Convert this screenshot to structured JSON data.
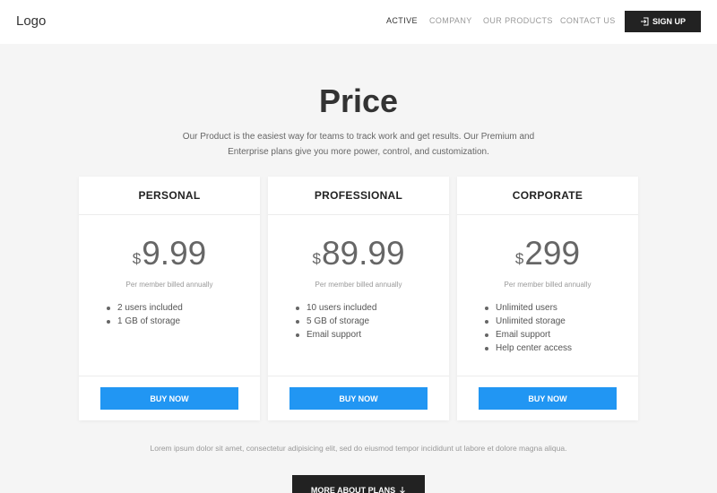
{
  "nav": {
    "logo": "Logo",
    "links": [
      "ACTIVE",
      "COMPANY",
      "OUR PRODUCTS",
      "CONTACT US"
    ],
    "signup_label": "SIGN UP",
    "signup_icon": "sign-in-icon"
  },
  "hero": {
    "title": "Price",
    "intro": "Our Product is the easiest way for teams to track work and get results. Our Premium and Enterprise plans give you more power, control, and customization."
  },
  "plans": [
    {
      "name": "PERSONAL",
      "currency": "$",
      "price": "9.99",
      "billing": "Per member billed annually",
      "features": [
        "2 users included",
        "1 GB of storage"
      ],
      "button": "BUY NOW"
    },
    {
      "name": "PROFESSIONAL",
      "currency": "$",
      "price": "89.99",
      "billing": "Per member billed annually",
      "features": [
        "10 users included",
        "5 GB of storage",
        "Email support"
      ],
      "button": "BUY NOW"
    },
    {
      "name": "CORPORATE",
      "currency": "$",
      "price": "299",
      "billing": "Per member billed annually",
      "features": [
        "Unlimited users",
        "Unlimited storage",
        "Email support",
        "Help center access"
      ],
      "button": "BUY NOW"
    }
  ],
  "footer": {
    "note": "Lorem ipsum dolor sit amet, consectetur adipisicing elit, sed do eiusmod tempor incididunt ut labore et dolore magna aliqua.",
    "more_label": "MORE ABOUT PLANS",
    "more_icon": "arrow-down-icon"
  },
  "colors": {
    "accent": "#2196f3",
    "dark": "#222222",
    "background": "#f5f5f5"
  }
}
